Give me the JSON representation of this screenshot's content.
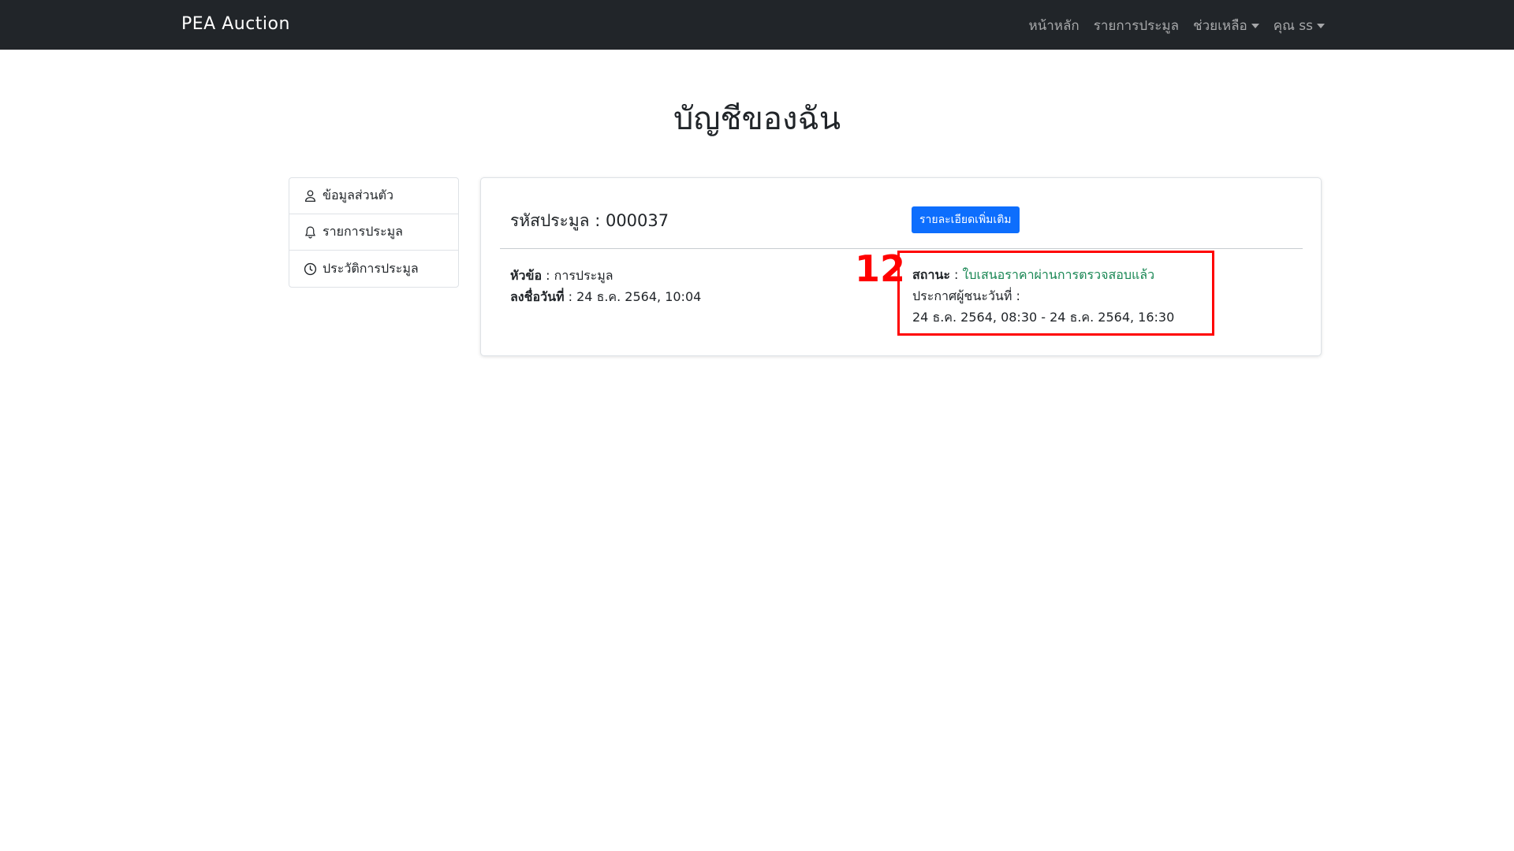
{
  "nav": {
    "brand": "PEA Auction",
    "items": [
      {
        "label": "หน้าหลัก",
        "dropdown": false
      },
      {
        "label": "รายการประมูล",
        "dropdown": false
      },
      {
        "label": "ช่วยเหลือ",
        "dropdown": true
      },
      {
        "label": "คุณ ss",
        "dropdown": true
      }
    ]
  },
  "page": {
    "title": "บัญชีของฉัน"
  },
  "sidebar": {
    "items": [
      {
        "label": "ข้อมูลส่วนตัว",
        "icon": "user-icon"
      },
      {
        "label": "รายการประมูล",
        "icon": "bell-icon"
      },
      {
        "label": "ประวัติการประมูล",
        "icon": "clock-icon"
      }
    ]
  },
  "card": {
    "code_label": "รหัสประมูล : 000037",
    "detail_button": "รายละเอียดเพิ่มเติม",
    "topic_label": "หัวข้อ",
    "topic_value": "การประมูล",
    "signup_label": "ลงชื่อวันที่",
    "signup_value": "24 ธ.ค. 2564, 10:04",
    "status_label": "สถานะ",
    "status_value": "ใบเสนอราคาผ่านการตรวจสอบแล้ว",
    "announce_label": "ประกาศผู้ชนะวันที่ :",
    "announce_range": "24 ธ.ค. 2564, 08:30 - 24 ธ.ค. 2564, 16:30"
  },
  "annotation": {
    "marker": "12",
    "color": "#ff0000"
  },
  "colors": {
    "navbar": "#212529",
    "primary": "#0d6efd",
    "status_success": "#198754"
  }
}
